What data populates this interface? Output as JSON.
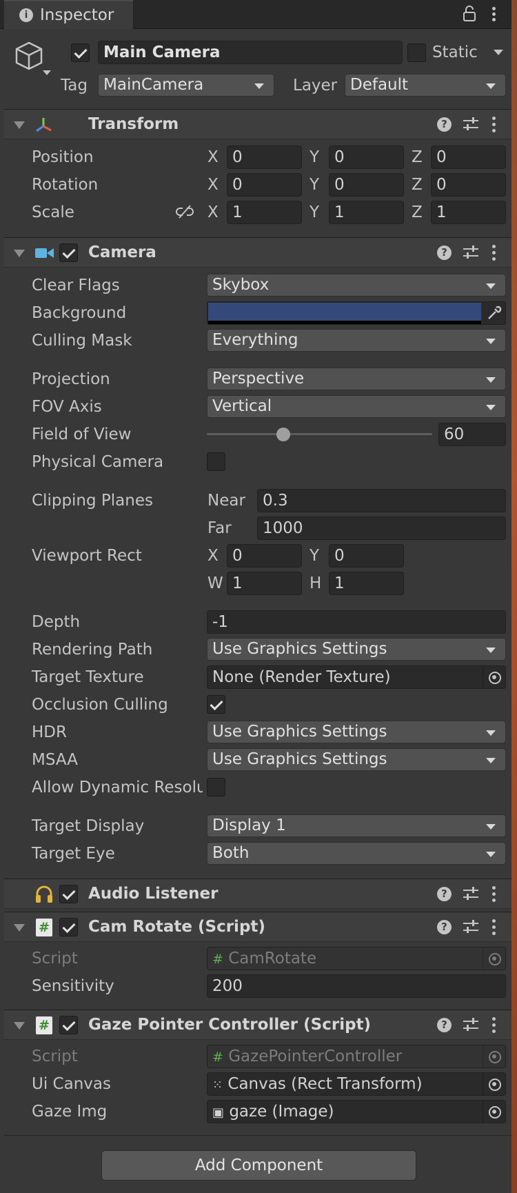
{
  "tab": {
    "title": "Inspector"
  },
  "gameobject": {
    "name": "Main Camera",
    "static_label": "Static",
    "tag_label": "Tag",
    "tag_value": "MainCamera",
    "layer_label": "Layer",
    "layer_value": "Default"
  },
  "transform": {
    "title": "Transform",
    "rows": [
      {
        "label": "Position",
        "x": "0",
        "y": "0",
        "z": "0"
      },
      {
        "label": "Rotation",
        "x": "0",
        "y": "0",
        "z": "0"
      },
      {
        "label": "Scale",
        "x": "1",
        "y": "1",
        "z": "1"
      }
    ],
    "axis": {
      "x": "X",
      "y": "Y",
      "z": "Z"
    }
  },
  "camera": {
    "title": "Camera",
    "clear_flags": {
      "label": "Clear Flags",
      "value": "Skybox"
    },
    "background": {
      "label": "Background",
      "color": "#34497a"
    },
    "culling_mask": {
      "label": "Culling Mask",
      "value": "Everything"
    },
    "projection": {
      "label": "Projection",
      "value": "Perspective"
    },
    "fov_axis": {
      "label": "FOV Axis",
      "value": "Vertical"
    },
    "field_of_view": {
      "label": "Field of View",
      "value": "60",
      "slider_fraction": 0.34
    },
    "physical_camera": {
      "label": "Physical Camera"
    },
    "clipping": {
      "label": "Clipping Planes",
      "near_label": "Near",
      "near": "0.3",
      "far_label": "Far",
      "far": "1000"
    },
    "viewport": {
      "label": "Viewport Rect",
      "x_label": "X",
      "x": "0",
      "y_label": "Y",
      "y": "0",
      "w_label": "W",
      "w": "1",
      "h_label": "H",
      "h": "1"
    },
    "depth": {
      "label": "Depth",
      "value": "-1"
    },
    "rendering_path": {
      "label": "Rendering Path",
      "value": "Use Graphics Settings"
    },
    "target_texture": {
      "label": "Target Texture",
      "value": "None (Render Texture)"
    },
    "occlusion_culling": {
      "label": "Occlusion Culling"
    },
    "hdr": {
      "label": "HDR",
      "value": "Use Graphics Settings"
    },
    "msaa": {
      "label": "MSAA",
      "value": "Use Graphics Settings"
    },
    "dynamic_resolution": {
      "label": "Allow Dynamic Resolu"
    },
    "target_display": {
      "label": "Target Display",
      "value": "Display 1"
    },
    "target_eye": {
      "label": "Target Eye",
      "value": "Both"
    }
  },
  "audio_listener": {
    "title": "Audio Listener"
  },
  "cam_rotate": {
    "title": "Cam Rotate (Script)",
    "script_label": "Script",
    "script_value": "CamRotate",
    "sensitivity_label": "Sensitivity",
    "sensitivity": "200"
  },
  "gaze": {
    "title": "Gaze Pointer Controller (Script)",
    "script_label": "Script",
    "script_value": "GazePointerController",
    "canvas_label": "Ui Canvas",
    "canvas_value": "Canvas (Rect Transform)",
    "img_label": "Gaze Img",
    "img_value": "gaze (Image)"
  },
  "add_component": "Add Component",
  "colors": {
    "accent_check": "#e0e0e0",
    "script_icon": "#5fae4f",
    "camera_icon": "#5fb3e0",
    "audio_icon": "#e3b43a"
  }
}
